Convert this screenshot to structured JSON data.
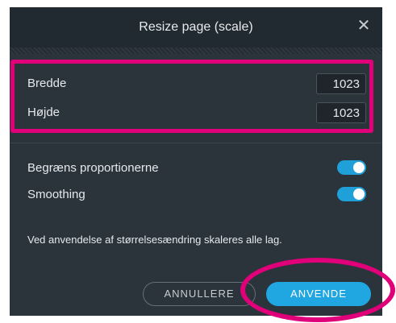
{
  "dialog": {
    "title": "Resize page (scale)",
    "close_icon": "close-icon"
  },
  "dimensions": {
    "width_label": "Bredde",
    "width_value": "1023",
    "height_label": "Højde",
    "height_value": "1023"
  },
  "options": {
    "constrain_label": "Begræns proportionerne",
    "constrain_on": true,
    "smoothing_label": "Smoothing",
    "smoothing_on": true
  },
  "note": "Ved anvendelse af størrelsesændring skaleres alle lag.",
  "buttons": {
    "cancel_label": "ANNULLERE",
    "apply_label": "ANVENDE"
  },
  "colors": {
    "accent": "#20a6e0",
    "highlight": "#e0007a",
    "dialog_bg": "#2b333b"
  }
}
